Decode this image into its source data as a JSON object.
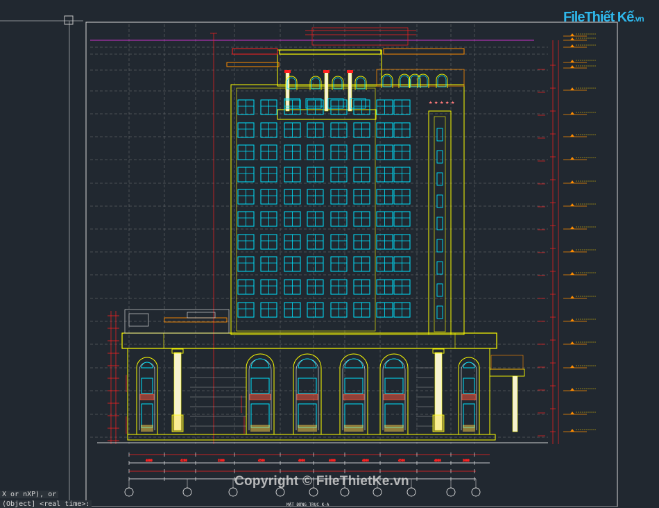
{
  "logo": {
    "main": "FileThiết Kế",
    "suffix": ".vn"
  },
  "watermark": "Copyright © FileThietKe.vn",
  "drawing_title": "MẶT ĐỨNG TRỤC K-A",
  "command_line": {
    "line1": "X or nXP), or",
    "line2": "(Object] <real time>:"
  },
  "colors": {
    "background": "#212830",
    "sheet_border": "#d9d9d9",
    "windows": "#00e5ff",
    "building_lines": "#ffff00",
    "dimension_red": "#ff2020",
    "level_marks": "#ff8c00",
    "roof_line": "#cc33cc"
  },
  "icons": [
    "axis-bubble-icon",
    "level-marker-icon",
    "arch-window-icon",
    "column-icon",
    "star-icon"
  ]
}
